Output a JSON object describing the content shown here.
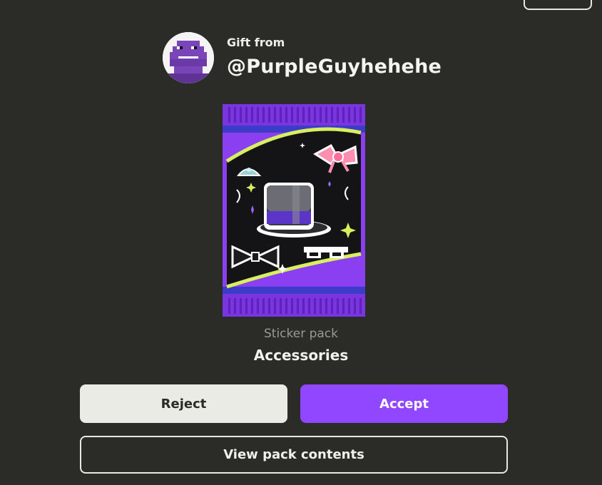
{
  "gift": {
    "from_label": "Gift from",
    "username": "@PurpleGuyhehehe"
  },
  "pack": {
    "type_label": "Sticker pack",
    "name": "Accessories",
    "icons": [
      "top-hat-icon",
      "bow-icon",
      "bow-tie-icon",
      "tiara-icon",
      "pixel-sunglasses-icon",
      "sparkle-icon"
    ]
  },
  "actions": {
    "reject_label": "Reject",
    "accept_label": "Accept",
    "view_label": "View pack contents"
  },
  "colors": {
    "background": "#2b2b27",
    "accent": "#9146ff",
    "pack_purple": "#8a3ff0",
    "neutral_button": "#ebebe6"
  }
}
